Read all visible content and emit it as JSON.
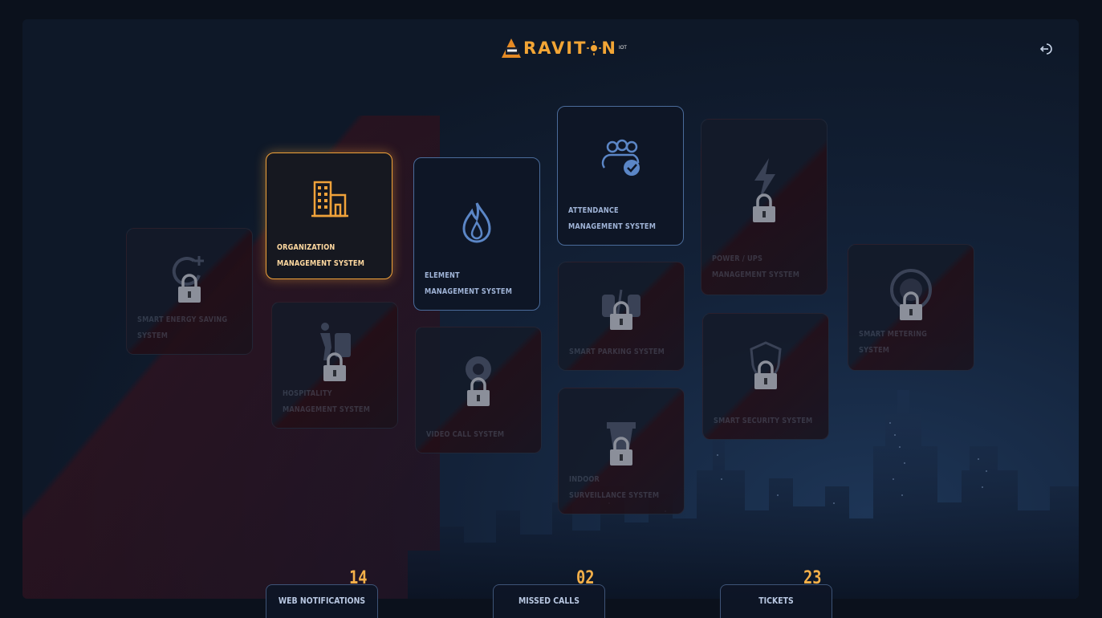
{
  "header": {
    "logo_text": "RAVIT",
    "logo_text_suffix": "N",
    "logo_superscript": "IOT",
    "logout_icon": "logout-icon"
  },
  "tiles": [
    {
      "label_line1": "SMART ENERGY SAVING",
      "label_line2": "SYSTEM",
      "state": "locked",
      "icon": "energy-saving-icon"
    },
    {
      "label_line1": "ORGANIZATION",
      "label_line2": "MANAGEMENT SYSTEM",
      "state": "active",
      "icon": "building-icon"
    },
    {
      "label_line1": "HOSPITALITY",
      "label_line2": "MANAGEMENT SYSTEM",
      "state": "locked",
      "icon": "hospitality-icon"
    },
    {
      "label_line1": "ELEMENT",
      "label_line2": "MANAGEMENT SYSTEM",
      "state": "available",
      "icon": "flame-icon"
    },
    {
      "label_line1": "VIDEO CALL SYSTEM",
      "label_line2": "",
      "state": "locked",
      "icon": "video-call-icon"
    },
    {
      "label_line1": "ATTENDANCE",
      "label_line2": "MANAGEMENT SYSTEM",
      "state": "available",
      "icon": "group-check-icon"
    },
    {
      "label_line1": "SMART PARKING SYSTEM",
      "label_line2": "",
      "state": "locked",
      "icon": "parking-icon"
    },
    {
      "label_line1": "INDOOR",
      "label_line2": "SURVEILLANCE SYSTEM",
      "state": "locked",
      "icon": "camera-icon"
    },
    {
      "label_line1": "POWER / UPS",
      "label_line2": "MANAGEMENT SYSTEM",
      "state": "locked",
      "icon": "lightning-icon"
    },
    {
      "label_line1": "SMART SECURITY SYSTEM",
      "label_line2": "",
      "state": "locked",
      "icon": "shield-icon"
    },
    {
      "label_line1": "SMART METERING",
      "label_line2": "SYSTEM",
      "state": "locked",
      "icon": "meter-icon"
    }
  ],
  "stats": [
    {
      "count": "14",
      "label": "WEB NOTIFICATIONS"
    },
    {
      "count": "02",
      "label": "MISSED CALLS"
    },
    {
      "count": "23",
      "label": "TICKETS"
    }
  ],
  "colors": {
    "accent_orange": "#f0a23a",
    "accent_blue": "#4a6b9a",
    "background": "#0b111c"
  }
}
